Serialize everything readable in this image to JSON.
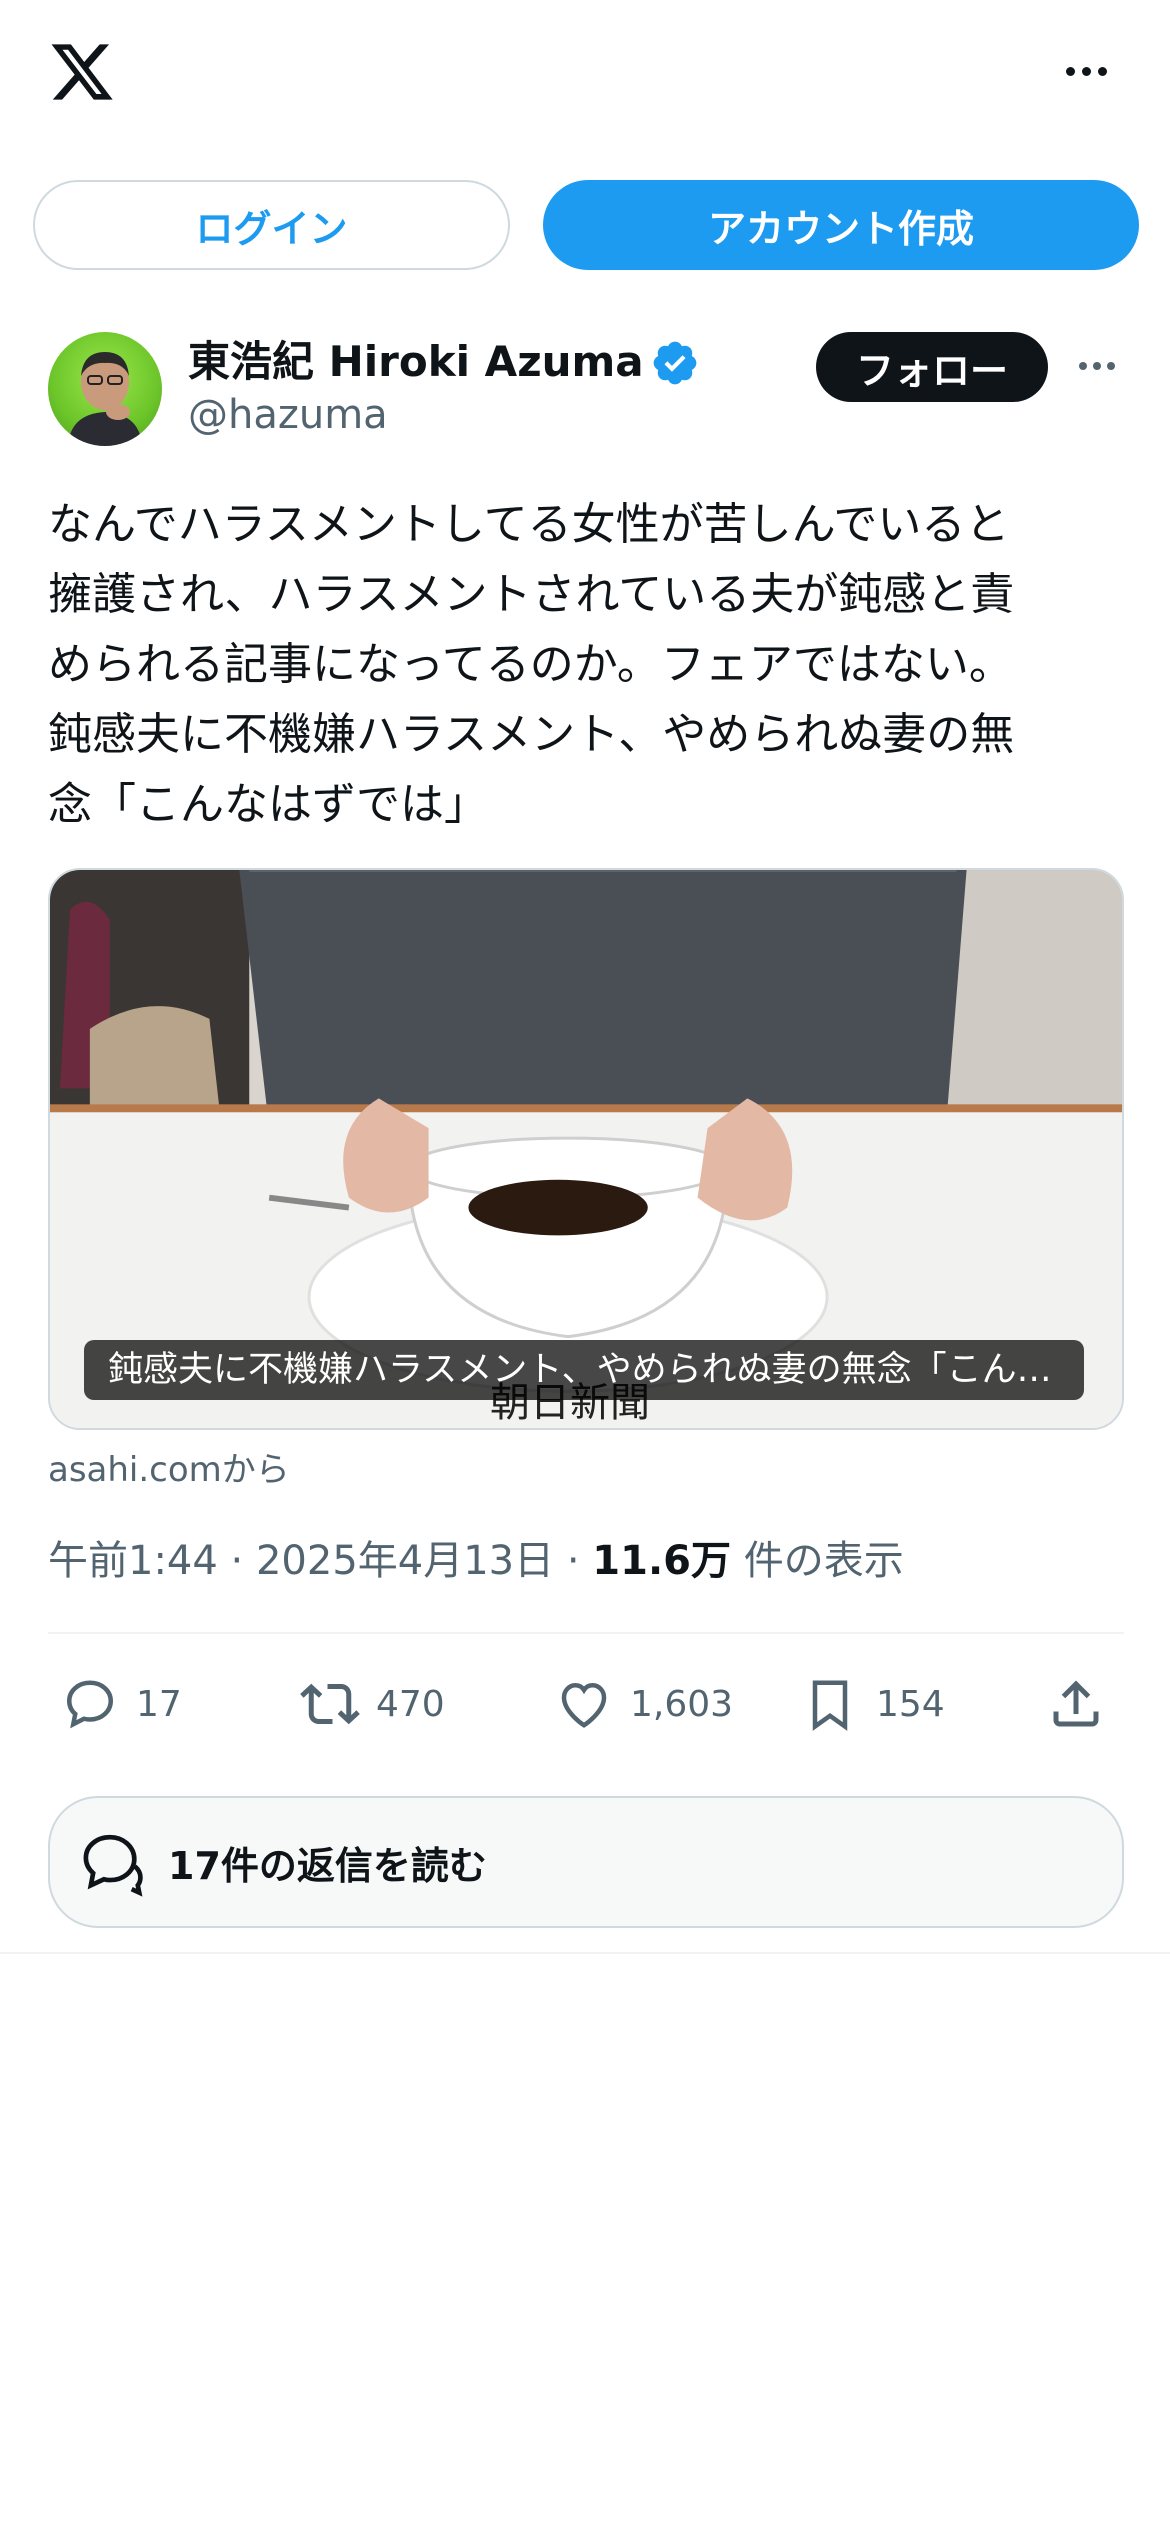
{
  "topbar": {
    "logo": "x-logo-icon",
    "more": "more-icon"
  },
  "auth": {
    "login_label": "ログイン",
    "signup_label": "アカウント作成"
  },
  "tweet": {
    "author_name": "東浩紀 Hiroki Azuma",
    "handle": "@hazuma",
    "verified_icon": "verified-badge-icon",
    "follow_label": "フォロー",
    "text": "なんでハラスメントしてる女性が苦しんでいると\n擁護され、ハラスメントされている夫が鈍感と責\nめられる記事になってるのか。フェアではない。\n鈍感夫に不機嫌ハラスメント、やめられぬ妻の無\n念「こんなはずでは」",
    "card": {
      "caption": "鈍感夫に不機嫌ハラスメント、やめられぬ妻の無念「こんなはずでは」",
      "watermark": "朝日新聞",
      "source": "asahi.comから"
    },
    "time": "午前1:44",
    "date": "2025年4月13日",
    "views_count": "11.6万",
    "views_label": "件の表示",
    "actions": {
      "replies": "17",
      "retweets": "470",
      "likes": "1,603",
      "bookmarks": "154"
    },
    "read_replies_label": "17件の返信を読む"
  },
  "colors": {
    "accent": "#1d9bf0",
    "text": "#0f1419",
    "muted": "#536471",
    "border": "#cfd9de"
  }
}
